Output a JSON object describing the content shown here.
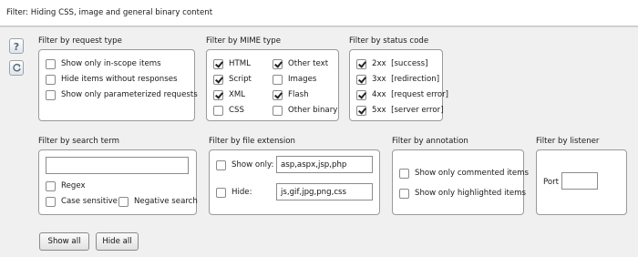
{
  "filter_bar": {
    "text": "Filter:  Hiding CSS, image and general binary content"
  },
  "side_buttons": {
    "help_icon": "question-icon",
    "refresh_icon": "refresh-icon"
  },
  "request_type": {
    "title": "Filter by request type",
    "items": [
      {
        "label": "Show only in-scope items",
        "checked": false
      },
      {
        "label": "Hide items without responses",
        "checked": false
      },
      {
        "label": "Show only parameterized requests",
        "checked": false
      }
    ]
  },
  "mime_type": {
    "title": "Filter by MIME type",
    "items": [
      {
        "label": "HTML",
        "checked": true
      },
      {
        "label": "Other text",
        "checked": true
      },
      {
        "label": "Script",
        "checked": true
      },
      {
        "label": "Images",
        "checked": false
      },
      {
        "label": "XML",
        "checked": true
      },
      {
        "label": "Flash",
        "checked": true
      },
      {
        "label": "CSS",
        "checked": false
      },
      {
        "label": "Other binary",
        "checked": false
      }
    ]
  },
  "status_code": {
    "title": "Filter by status code",
    "items": [
      {
        "label": "2xx  [success]",
        "checked": true
      },
      {
        "label": "3xx  [redirection]",
        "checked": true
      },
      {
        "label": "4xx  [request error]",
        "checked": true
      },
      {
        "label": "5xx  [server error]",
        "checked": true
      }
    ]
  },
  "search_term": {
    "title": "Filter by search term",
    "value": "",
    "regex": {
      "label": "Regex",
      "checked": false
    },
    "case_sensitive": {
      "label": "Case sensitive",
      "checked": false
    },
    "negative": {
      "label": "Negative search",
      "checked": false
    }
  },
  "file_extension": {
    "title": "Filter by file extension",
    "show_only": {
      "label": "Show only:",
      "checked": false,
      "value": "asp,aspx,jsp,php"
    },
    "hide": {
      "label": "Hide:",
      "checked": false,
      "value": "js,gif,jpg,png,css"
    }
  },
  "annotation": {
    "title": "Filter by annotation",
    "items": [
      {
        "label": "Show only commented items",
        "checked": false
      },
      {
        "label": "Show only highlighted items",
        "checked": false
      }
    ]
  },
  "listener": {
    "title": "Filter by listener",
    "port_label": "Port",
    "port_value": ""
  },
  "buttons": {
    "show_all": "Show all",
    "hide_all": "Hide all"
  }
}
